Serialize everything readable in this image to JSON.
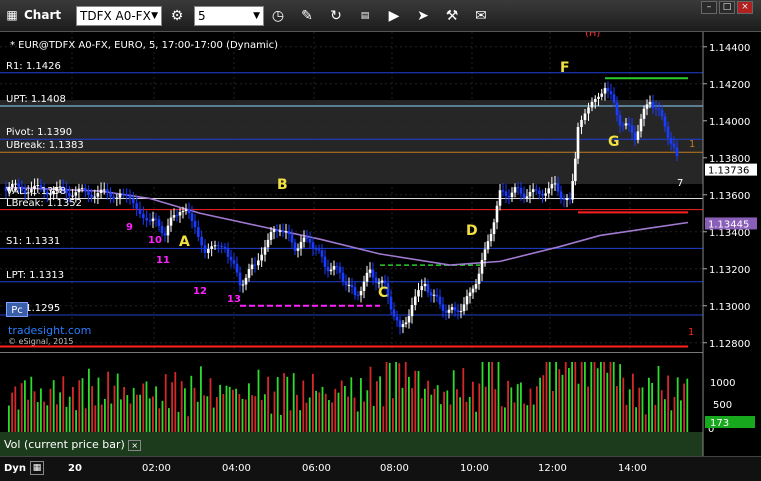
{
  "titlebar": {
    "app_title": "Chart",
    "symbol": "TDFX A0-FX",
    "interval": "5",
    "win_min": "–",
    "win_max": "□",
    "win_close": "×",
    "icons": [
      "clock-settings-icon",
      "history-icon",
      "pencil-icon",
      "refresh-icon",
      "quote-icon",
      "play-icon",
      "tools-icon",
      "chat-icon"
    ]
  },
  "chart": {
    "header": "* EUR@TDFX A0-FX, EURO, 5, 17:00-17:00 (Dynamic)",
    "brand": "tradesight.com",
    "copyright": "© eSignal, 2015",
    "pc_label": "Pc",
    "top_marker": "(H)",
    "price_axis": [
      "1.14400",
      "1.14200",
      "1.14000",
      "1.13800",
      "1.13600",
      "1.13400",
      "1.13200",
      "1.13000",
      "1.12800"
    ],
    "current_price": "1.13736",
    "ma_price": "1.13445",
    "levels": [
      {
        "label": "R1: 1.1426",
        "value": 1.1426,
        "color": "#1f3fd6"
      },
      {
        "label": "UPT: 1.1408",
        "value": 1.1408,
        "color": "#8fd7ff"
      },
      {
        "label": "Pivot: 1.1390",
        "value": 1.139,
        "color": "#1f3fd6"
      },
      {
        "label": "UBreak: 1.1383",
        "value": 1.1383,
        "color": "#c07a1c"
      },
      {
        "label": "VAL: 1.1358",
        "value": 1.1358,
        "color": "#d8d8d8"
      },
      {
        "label": "LBreak: 1.1352",
        "value": 1.1352,
        "color": "#ff2020"
      },
      {
        "label": "S1: 1.1331",
        "value": 1.1331,
        "color": "#1f3fd6"
      },
      {
        "label": "LPT: 1.1313",
        "value": 1.1313,
        "color": "#1f3fd6"
      },
      {
        "label": "S2: 1.1295",
        "value": 1.1295,
        "color": "#1f3fd6"
      }
    ],
    "annotations": [
      {
        "text": "F",
        "kind": "letter"
      },
      {
        "text": "G",
        "kind": "letter"
      },
      {
        "text": "B",
        "kind": "letter"
      },
      {
        "text": "A",
        "kind": "letter"
      },
      {
        "text": "C",
        "kind": "letter"
      },
      {
        "text": "D",
        "kind": "letter"
      },
      {
        "text": "9",
        "kind": "count"
      },
      {
        "text": "10",
        "kind": "count"
      },
      {
        "text": "11",
        "kind": "count"
      },
      {
        "text": "12",
        "kind": "count"
      },
      {
        "text": "13",
        "kind": "count"
      }
    ],
    "right_markers": [
      "1",
      "7",
      "1"
    ]
  },
  "volume": {
    "label": "Vol (current price bar)",
    "axis": [
      "1000",
      "500",
      "0"
    ],
    "current": "173"
  },
  "timeaxis": {
    "dyn": "Dyn",
    "labels": [
      "20",
      "02:00",
      "04:00",
      "06:00",
      "08:00",
      "10:00",
      "12:00",
      "14:00"
    ]
  },
  "chart_data": {
    "type": "line",
    "x": [
      "20",
      "02:00",
      "04:00",
      "06:00",
      "08:00",
      "10:00",
      "12:00",
      "14:00"
    ],
    "series": [
      {
        "values": [
          1.1362,
          1.1338,
          1.1318,
          1.1332,
          1.1285,
          1.132,
          1.14,
          1.1372
        ]
      }
    ],
    "ylim": [
      1.1275,
      1.1448
    ],
    "grid": true
  },
  "colors": {
    "background": "#000000",
    "up_bar": "#ffffff",
    "down_bar": "#1a3cff",
    "ma_line": "#a07ad0",
    "count_magenta": "#ff22ff",
    "letter_yellow": "#f0e040",
    "vol_green": "#2bdd2b",
    "vol_red": "#d62828"
  }
}
